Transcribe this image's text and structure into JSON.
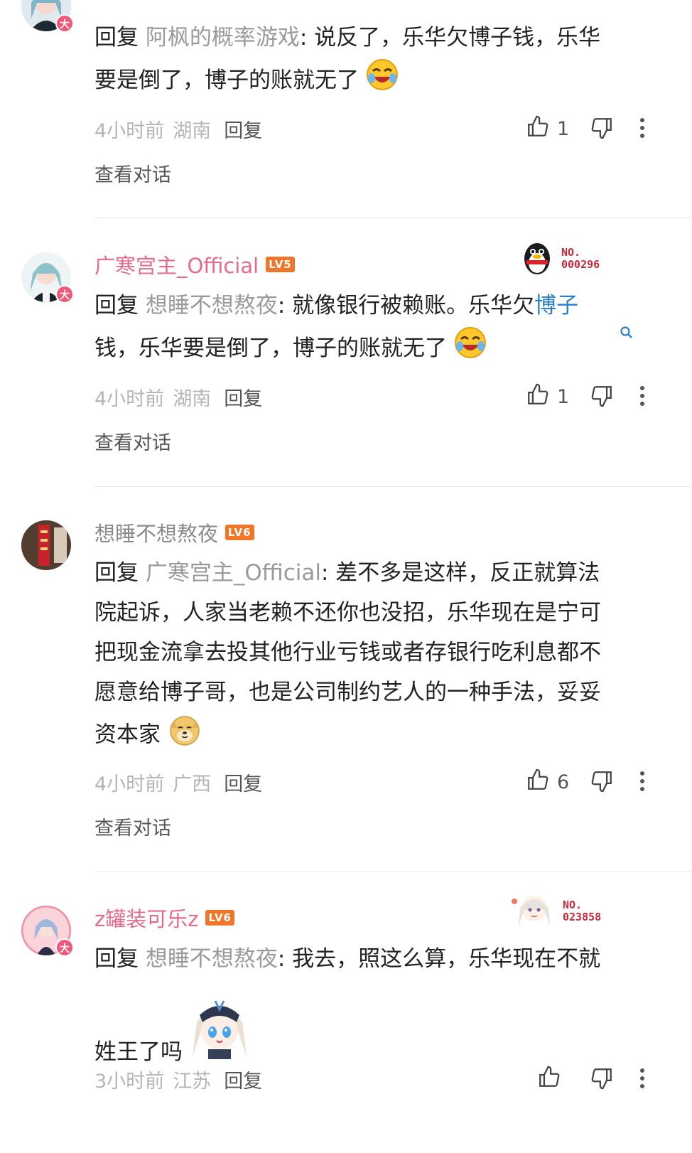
{
  "comments": [
    {
      "username": "",
      "body_prefix": "回复 ",
      "mention": "阿枫的概率游戏",
      "body_line1_rest": ": 说反了，乐华欠博子钱，乐华",
      "body_line2": "要是倒了，博子的账就无了",
      "time": "4小时前",
      "location": "湖南",
      "reply_label": "回复",
      "likes": "1",
      "view_conversation": "查看对话"
    },
    {
      "username": "广寒宫主_Official",
      "level": "LV5",
      "fan_no_label": "NO.",
      "fan_no": "000296",
      "body_prefix": "回复 ",
      "mention": "想睡不想熬夜",
      "body_line1_rest": ": 就像银行被赖账。乐华欠",
      "body_link": "博子",
      "body_line2": "钱，乐华要是倒了，博子的账就无了",
      "time": "4小时前",
      "location": "湖南",
      "reply_label": "回复",
      "likes": "1",
      "view_conversation": "查看对话"
    },
    {
      "username": "想睡不想熬夜",
      "level": "LV6",
      "body_prefix": "回复 ",
      "mention": "广寒宫主_Official",
      "body_line1_rest": ": 差不多是这样，反正就算法",
      "body_line2": "院起诉，人家当老赖不还你也没招，乐华现在是宁可",
      "body_line3": "把现金流拿去投其他行业亏钱或者存银行吃利息都不",
      "body_line4": "愿意给博子哥，也是公司制约艺人的一种手法，妥妥",
      "body_line5": "资本家",
      "time": "4小时前",
      "location": "广西",
      "reply_label": "回复",
      "likes": "6",
      "view_conversation": "查看对话"
    },
    {
      "username": "z罐装可乐z",
      "level": "LV6",
      "fan_no_label": "NO.",
      "fan_no": "023858",
      "body_prefix": "回复 ",
      "mention": "想睡不想熬夜",
      "body_line1_rest": ": 我去，照这么算，乐华现在不就",
      "body_line2": "姓王了吗",
      "time": "3小时前",
      "location": "江苏",
      "reply_label": "回复",
      "likes": ""
    }
  ],
  "avatar_badge": "大",
  "colors": {
    "pink_name": "#e66a8a",
    "level_badge": "#f0762a",
    "link": "#2a7fc8",
    "mention": "#9a9a9a"
  },
  "icons": [
    "thumbs-up-icon",
    "thumbs-down-icon",
    "more-vertical-icon",
    "search-icon",
    "laughing-crying-emoji",
    "doge-emoji",
    "anime-sticker"
  ]
}
